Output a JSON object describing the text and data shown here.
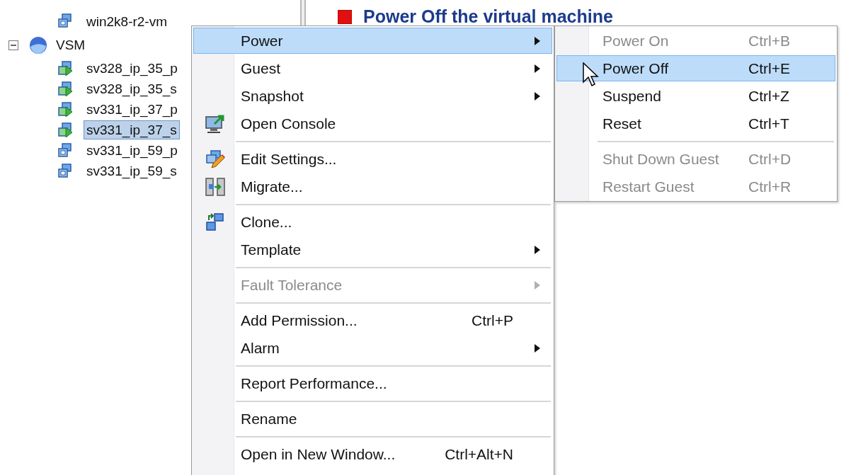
{
  "tree": [
    {
      "kind": "vm",
      "label": "win2k8-r2-vm",
      "running": false,
      "selected": false
    },
    {
      "kind": "folder",
      "label": "VSM",
      "expanded": true,
      "children": [
        {
          "kind": "vm",
          "label": "sv328_ip_35_p",
          "running": true,
          "selected": false
        },
        {
          "kind": "vm",
          "label": "sv328_ip_35_s",
          "running": true,
          "selected": false
        },
        {
          "kind": "vm",
          "label": "sv331_ip_37_p",
          "running": true,
          "selected": false
        },
        {
          "kind": "vm",
          "label": "sv331_ip_37_s",
          "running": true,
          "selected": true
        },
        {
          "kind": "vm",
          "label": "sv331_ip_59_p",
          "running": false,
          "selected": false
        },
        {
          "kind": "vm",
          "label": "sv331_ip_59_s",
          "running": false,
          "selected": false
        }
      ]
    }
  ],
  "heading": {
    "title": "Power Off the virtual machine"
  },
  "context_menu": [
    {
      "kind": "item",
      "label": "Power",
      "submenu": true,
      "disabled": false,
      "selected": true
    },
    {
      "kind": "item",
      "label": "Guest",
      "submenu": true,
      "disabled": false,
      "selected": false
    },
    {
      "kind": "item",
      "label": "Snapshot",
      "submenu": true,
      "disabled": false,
      "selected": false
    },
    {
      "kind": "item",
      "label": "Open Console",
      "submenu": false,
      "disabled": false,
      "selected": false
    },
    {
      "kind": "separator"
    },
    {
      "kind": "item",
      "label": "Edit Settings...",
      "submenu": false,
      "disabled": false,
      "selected": false
    },
    {
      "kind": "item",
      "label": "Migrate...",
      "submenu": false,
      "disabled": false,
      "selected": false
    },
    {
      "kind": "separator"
    },
    {
      "kind": "item",
      "label": "Clone...",
      "submenu": false,
      "disabled": false,
      "selected": false
    },
    {
      "kind": "item",
      "label": "Template",
      "submenu": true,
      "disabled": false,
      "selected": false
    },
    {
      "kind": "separator"
    },
    {
      "kind": "item",
      "label": "Fault Tolerance",
      "submenu": true,
      "disabled": true,
      "selected": false
    },
    {
      "kind": "separator"
    },
    {
      "kind": "item",
      "label": "Add Permission...",
      "shortcut": "Ctrl+P",
      "submenu": false,
      "disabled": false,
      "selected": false
    },
    {
      "kind": "item",
      "label": "Alarm",
      "submenu": true,
      "disabled": false,
      "selected": false
    },
    {
      "kind": "separator"
    },
    {
      "kind": "item",
      "label": "Report Performance...",
      "submenu": false,
      "disabled": false,
      "selected": false
    },
    {
      "kind": "separator"
    },
    {
      "kind": "item",
      "label": "Rename",
      "submenu": false,
      "disabled": false,
      "selected": false
    },
    {
      "kind": "separator"
    },
    {
      "kind": "item",
      "label": "Open in New Window...",
      "shortcut": "Ctrl+Alt+N",
      "submenu": false,
      "disabled": false,
      "selected": false
    }
  ],
  "power_submenu": [
    {
      "kind": "item",
      "label": "Power On",
      "shortcut": "Ctrl+B",
      "disabled": true,
      "selected": false
    },
    {
      "kind": "item",
      "label": "Power Off",
      "shortcut": "Ctrl+E",
      "disabled": false,
      "selected": true
    },
    {
      "kind": "item",
      "label": "Suspend",
      "shortcut": "Ctrl+Z",
      "disabled": false,
      "selected": false
    },
    {
      "kind": "item",
      "label": "Reset",
      "shortcut": "Ctrl+T",
      "disabled": false,
      "selected": false
    },
    {
      "kind": "separator"
    },
    {
      "kind": "item",
      "label": "Shut Down Guest",
      "shortcut": "Ctrl+D",
      "disabled": true,
      "selected": false
    },
    {
      "kind": "item",
      "label": "Restart Guest",
      "shortcut": "Ctrl+R",
      "disabled": true,
      "selected": false
    }
  ]
}
